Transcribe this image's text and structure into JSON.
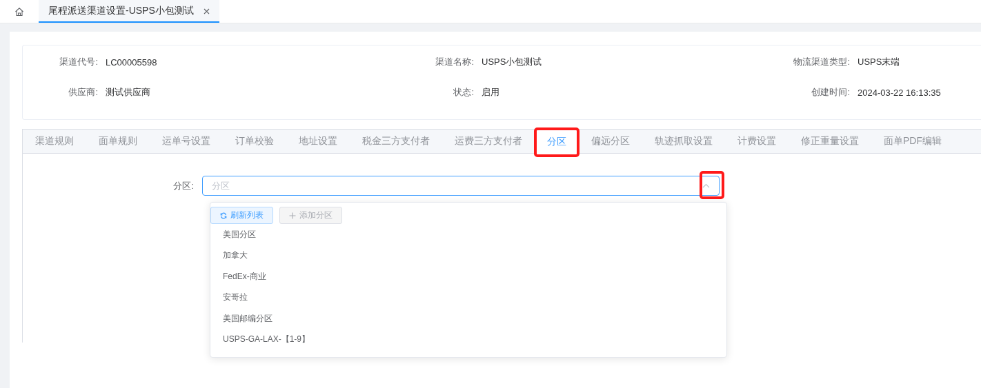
{
  "page_tabs": [
    {
      "label": "尾程派送渠道设置-USPS小包测试",
      "selected": true
    }
  ],
  "info": [
    {
      "label": "渠道代号:",
      "value": "LC00005598"
    },
    {
      "label": "渠道名称:",
      "value": "USPS小包测试"
    },
    {
      "label": "物流渠道类型:",
      "value": "USPS末端"
    },
    {
      "label": "供应商:",
      "value": "测试供应商"
    },
    {
      "label": "状态:",
      "value": "启用"
    },
    {
      "label": "创建时间:",
      "value": "2024-03-22 16:13:35"
    }
  ],
  "tabs": [
    {
      "label": "渠道规则",
      "selected": false,
      "highlighted": false
    },
    {
      "label": "面单规则",
      "selected": false,
      "highlighted": false
    },
    {
      "label": "运单号设置",
      "selected": false,
      "highlighted": false
    },
    {
      "label": "订单校验",
      "selected": false,
      "highlighted": false
    },
    {
      "label": "地址设置",
      "selected": false,
      "highlighted": false
    },
    {
      "label": "税金三方支付者",
      "selected": false,
      "highlighted": false
    },
    {
      "label": "运费三方支付者",
      "selected": false,
      "highlighted": false
    },
    {
      "label": "分区",
      "selected": true,
      "highlighted": true
    },
    {
      "label": "偏远分区",
      "selected": false,
      "highlighted": false
    },
    {
      "label": "轨迹抓取设置",
      "selected": false,
      "highlighted": false
    },
    {
      "label": "计费设置",
      "selected": false,
      "highlighted": false
    },
    {
      "label": "修正重量设置",
      "selected": false,
      "highlighted": false
    },
    {
      "label": "面单PDF编辑",
      "selected": false,
      "highlighted": false
    }
  ],
  "zone_field": {
    "label": "分区:",
    "placeholder": "分区",
    "expanded": true,
    "arrow_highlighted": true
  },
  "dropdown": {
    "buttons": [
      {
        "label": "刷新列表",
        "kind": "refresh",
        "disabled": false
      },
      {
        "label": "添加分区",
        "kind": "add",
        "disabled": true
      }
    ],
    "options": [
      "美国分区",
      "加拿大",
      "FedEx-商业",
      "安哥拉",
      "美国邮编分区",
      "USPS-GA-LAX-【1-9】"
    ]
  }
}
